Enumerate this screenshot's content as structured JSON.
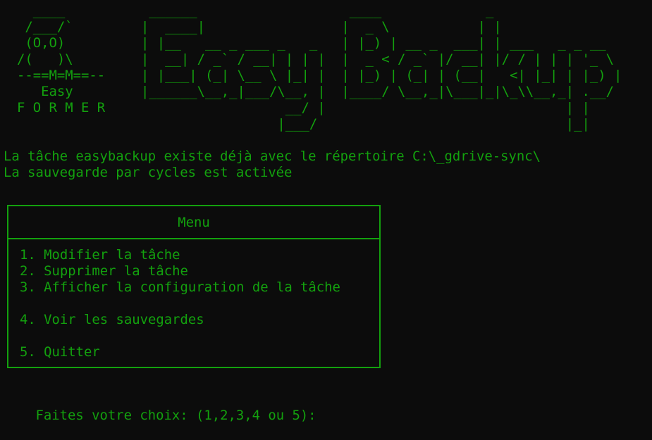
{
  "banner": {
    "owl_art": "  ____\n /___/`\n (O,O)\n/(   )\\\n--==M=M==--\n   Easy\nF O R M E R",
    "title_art": " ______                   ____             _\n|  ____|                 |  _ \\           | |\n| |__   __ _ ___ _   _   | |_) | __ _  ___| | ___   _ _ __\n|  __| / _` / __| | | |  |  _ < / _` |/ __| |/ / | | | '_ \\\n| |___| (_| \\__ \\ |_| |  | |_) | (_| | (__|   <| |_| | |_) |\n|______\\__,_|___/\\__, |  |____/ \\__,_|\\___|_|\\_\\\\__,_| .__/\n                  __/ |                              | |\n                 |___/                               |_|"
  },
  "status": {
    "line1": "La tâche easybackup existe déjà avec le répertoire C:\\_gdrive-sync\\",
    "line2": "La sauvegarde par cycles est activée"
  },
  "menu": {
    "title": "Menu",
    "items": [
      {
        "label": "1. Modifier la tâche"
      },
      {
        "label": "2. Supprimer la tâche"
      },
      {
        "label": "3. Afficher la configuration de la tâche"
      },
      {
        "label": "4. Voir les sauvegardes"
      },
      {
        "label": "5. Quitter"
      }
    ]
  },
  "prompt": {
    "text": "Faites votre choix: (1,2,3,4 ou 5):"
  },
  "colors": {
    "background": "#0c0c0c",
    "foreground": "#13a10e"
  }
}
